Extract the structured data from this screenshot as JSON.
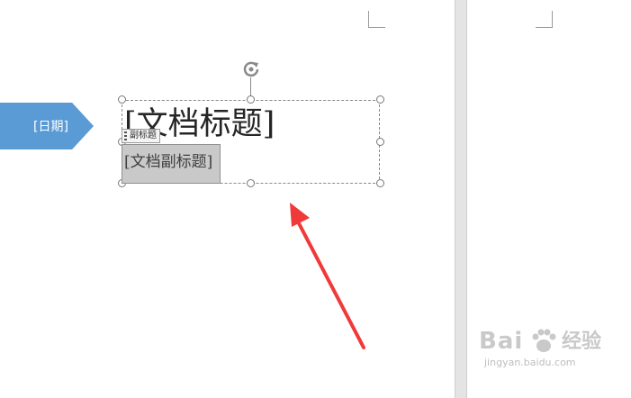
{
  "document": {
    "date_placeholder": "[日期]",
    "title_placeholder": "[文档标题]",
    "subtitle_tag": "副标题",
    "subtitle_placeholder": "[文档副标题]"
  },
  "watermark": {
    "logo_text": "Bai",
    "brand_cn": "经验",
    "url": "jingyan.baidu.com"
  },
  "colors": {
    "date_block": "#5b9bd5",
    "annotation_arrow": "#f03a3a",
    "subtitle_selection": "#c9c9c9"
  },
  "icons": {
    "rotate_handle": "rotate-icon",
    "arrow": "red-arrow-annotation"
  }
}
